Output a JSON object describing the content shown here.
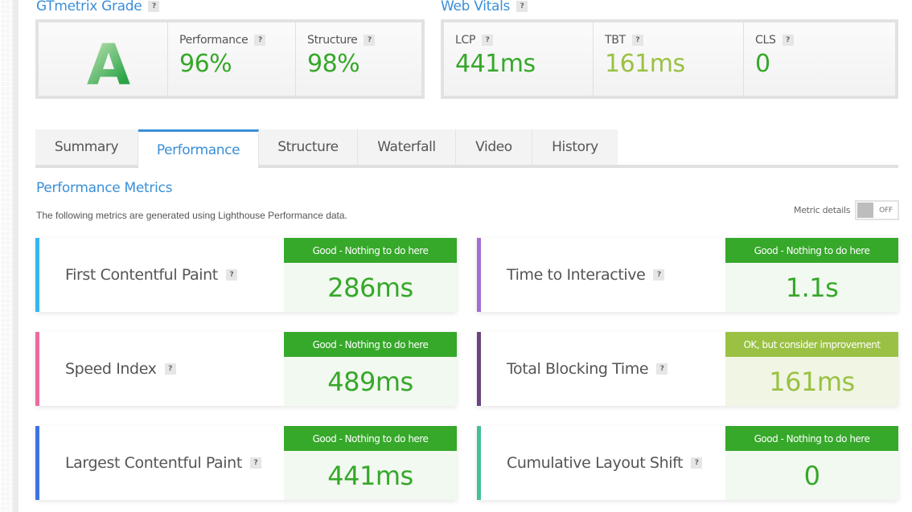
{
  "colors": {
    "accent": "#3a8fd8",
    "good": "#36a82a",
    "good_bg": "#f2f9f0",
    "ok": "#9ac143",
    "ok_bg": "#f0f5e4"
  },
  "grade_section": {
    "title": "GTmetrix Grade",
    "help": "?",
    "grade": "A",
    "performance": {
      "label": "Performance",
      "help": "?",
      "value": "96%"
    },
    "structure": {
      "label": "Structure",
      "help": "?",
      "value": "98%"
    }
  },
  "web_vitals": {
    "title": "Web Vitals",
    "help": "?",
    "items": [
      {
        "label": "LCP",
        "help": "?",
        "value": "441ms",
        "status": "good"
      },
      {
        "label": "TBT",
        "help": "?",
        "value": "161ms",
        "status": "ok"
      },
      {
        "label": "CLS",
        "help": "?",
        "value": "0",
        "status": "good"
      }
    ]
  },
  "tabs": [
    {
      "label": "Summary",
      "active": false
    },
    {
      "label": "Performance",
      "active": true
    },
    {
      "label": "Structure",
      "active": false
    },
    {
      "label": "Waterfall",
      "active": false
    },
    {
      "label": "Video",
      "active": false
    },
    {
      "label": "History",
      "active": false
    }
  ],
  "performance_metrics": {
    "title": "Performance Metrics",
    "description": "The following metrics are generated using Lighthouse Performance data.",
    "metric_details": {
      "label": "Metric details",
      "state": "OFF"
    },
    "metrics": [
      {
        "name": "First Contentful Paint",
        "help": "?",
        "badge": "Good - Nothing to do here",
        "value": "286ms",
        "status": "good",
        "bar_color": "#35b6ef"
      },
      {
        "name": "Time to Interactive",
        "help": "?",
        "badge": "Good - Nothing to do here",
        "value": "1.1s",
        "status": "good",
        "bar_color": "#a16fd0"
      },
      {
        "name": "Speed Index",
        "help": "?",
        "badge": "Good - Nothing to do here",
        "value": "489ms",
        "status": "good",
        "bar_color": "#ec6aa0"
      },
      {
        "name": "Total Blocking Time",
        "help": "?",
        "badge": "OK, but consider improvement",
        "value": "161ms",
        "status": "ok",
        "bar_color": "#6b4482"
      },
      {
        "name": "Largest Contentful Paint",
        "help": "?",
        "badge": "Good - Nothing to do here",
        "value": "441ms",
        "status": "good",
        "bar_color": "#3d73e0"
      },
      {
        "name": "Cumulative Layout Shift",
        "help": "?",
        "badge": "Good - Nothing to do here",
        "value": "0",
        "status": "good",
        "bar_color": "#45c096"
      }
    ]
  }
}
